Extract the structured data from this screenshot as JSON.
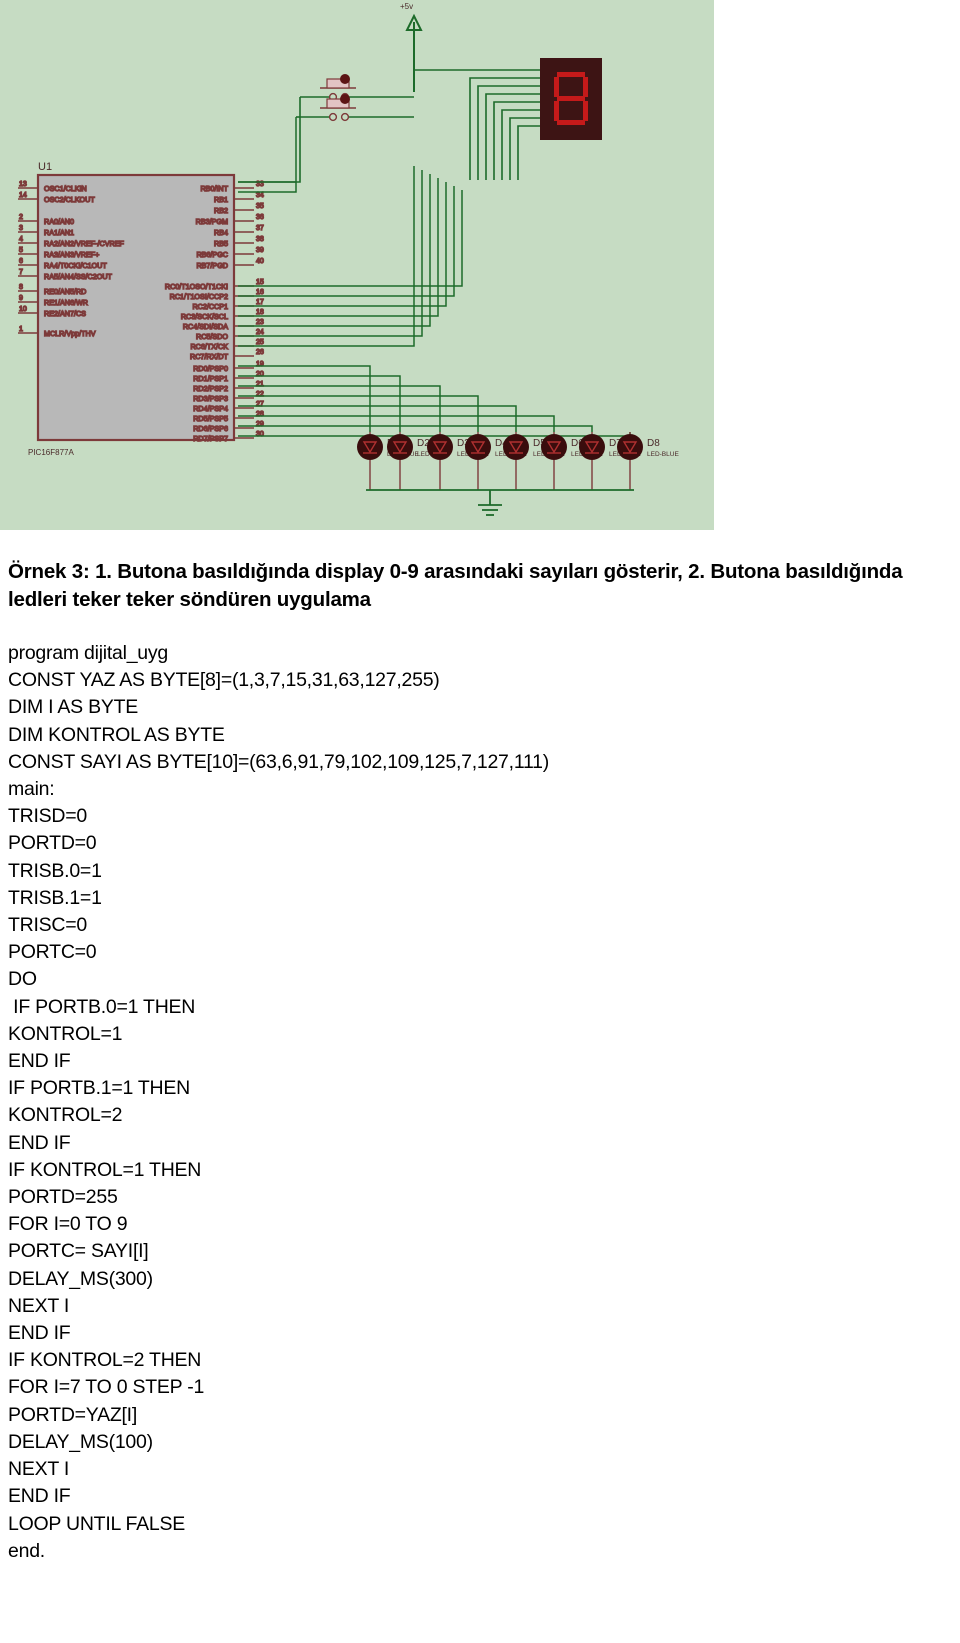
{
  "schematic": {
    "power_rail_label": "+5v",
    "chip": {
      "ref": "U1",
      "part": "PIC16F877A",
      "left_pins": [
        {
          "num": "13",
          "label": "OSC1/CLKIN"
        },
        {
          "num": "14",
          "label": "OSC2/CLKOUT"
        },
        {
          "num": "2",
          "label": "RA0/AN0"
        },
        {
          "num": "3",
          "label": "RA1/AN1"
        },
        {
          "num": "4",
          "label": "RA2/AN2/VREF-/CVREF"
        },
        {
          "num": "5",
          "label": "RA3/AN3/VREF+"
        },
        {
          "num": "6",
          "label": "RA4/T0CKI/C1OUT"
        },
        {
          "num": "7",
          "label": "RA5/AN4/SS/C2OUT"
        },
        {
          "num": "8",
          "label": "RE0/AN5/RD"
        },
        {
          "num": "9",
          "label": "RE1/AN6/WR"
        },
        {
          "num": "10",
          "label": "RE2/AN7/CS"
        },
        {
          "num": "1",
          "label": "MCLR/Vpp/THV"
        }
      ],
      "right_pins": [
        {
          "num": "33",
          "label": "RB0/INT"
        },
        {
          "num": "34",
          "label": "RB1"
        },
        {
          "num": "35",
          "label": "RB2"
        },
        {
          "num": "36",
          "label": "RB3/PGM"
        },
        {
          "num": "37",
          "label": "RB4"
        },
        {
          "num": "38",
          "label": "RB5"
        },
        {
          "num": "39",
          "label": "RB6/PGC"
        },
        {
          "num": "40",
          "label": "RB7/PGD"
        },
        {
          "num": "15",
          "label": "RC0/T1OSO/T1CKI"
        },
        {
          "num": "16",
          "label": "RC1/T1OSI/CCP2"
        },
        {
          "num": "17",
          "label": "RC2/CCP1"
        },
        {
          "num": "18",
          "label": "RC3/SCK/SCL"
        },
        {
          "num": "23",
          "label": "RC4/SDI/SDA"
        },
        {
          "num": "24",
          "label": "RC5/SDO"
        },
        {
          "num": "25",
          "label": "RC6/TX/CK"
        },
        {
          "num": "26",
          "label": "RC7/RX/DT"
        },
        {
          "num": "19",
          "label": "RD0/PSP0"
        },
        {
          "num": "20",
          "label": "RD1/PSP1"
        },
        {
          "num": "21",
          "label": "RD2/PSP2"
        },
        {
          "num": "22",
          "label": "RD3/PSP3"
        },
        {
          "num": "27",
          "label": "RD4/PSP4"
        },
        {
          "num": "28",
          "label": "RD5/PSP5"
        },
        {
          "num": "29",
          "label": "RD6/PSP6"
        },
        {
          "num": "30",
          "label": "RD7/PSP7"
        }
      ]
    },
    "leds": [
      {
        "ref": "D1",
        "part": "LED-BLUE"
      },
      {
        "ref": "D2",
        "part": "LED-BLUE"
      },
      {
        "ref": "D3",
        "part": "LED-BLUE"
      },
      {
        "ref": "D4",
        "part": "LED-BLUE"
      },
      {
        "ref": "D5",
        "part": "LED-BLUE"
      },
      {
        "ref": "D6",
        "part": "LED-BLUE"
      },
      {
        "ref": "D7",
        "part": "LED-BLUE"
      },
      {
        "ref": "D8",
        "part": "LED-BLUE"
      }
    ],
    "display": {
      "digit": "8"
    },
    "buttons": [
      {
        "name": "button-1"
      },
      {
        "name": "button-2"
      }
    ],
    "colors": {
      "background": "#c6dcc3",
      "wire": "#1d6b2a",
      "body_outline": "#7d3a3a",
      "body_fill": "#b8b8b8",
      "led_body": "#3a0d0d",
      "display_body": "#3d1414",
      "segment_on": "#c41a1a"
    }
  },
  "heading": "Örnek 3: 1. Butona basıldığında display 0-9 arasındaki sayıları gösterir, 2. Butona basıldığında ledleri teker teker söndüren uygulama",
  "code": {
    "lines": [
      "program dijital_uyg",
      "CONST YAZ AS BYTE[8]=(1,3,7,15,31,63,127,255)",
      "DIM I AS BYTE",
      "DIM KONTROL AS BYTE",
      "CONST SAYI AS BYTE[10]=(63,6,91,79,102,109,125,7,127,111)",
      "main:",
      "TRISD=0",
      "PORTD=0",
      "TRISB.0=1",
      "TRISB.1=1",
      "TRISC=0",
      "PORTC=0",
      "DO",
      " IF PORTB.0=1 THEN",
      "KONTROL=1",
      "END IF",
      "IF PORTB.1=1 THEN",
      "KONTROL=2",
      "END IF",
      "IF KONTROL=1 THEN",
      "PORTD=255",
      "FOR I=0 TO 9",
      "PORTC= SAYI[I]",
      "DELAY_MS(300)",
      "NEXT I",
      "END IF",
      "IF KONTROL=2 THEN",
      "FOR I=7 TO 0 STEP -1",
      "PORTD=YAZ[I]",
      "DELAY_MS(100)",
      "NEXT I",
      "END IF",
      "LOOP UNTIL FALSE",
      "end."
    ]
  }
}
